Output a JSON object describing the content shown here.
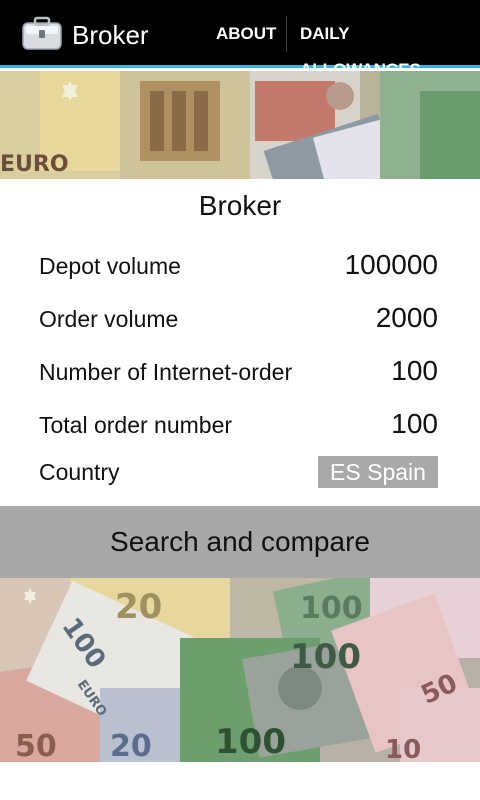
{
  "app": {
    "title": "Broker",
    "icon": "briefcase-icon",
    "menu": {
      "about_label": "ABOUT",
      "daily_allowances_label": "DAILY ALLOWANCES"
    }
  },
  "form": {
    "title": "Broker",
    "depot_volume": {
      "label": "Depot volume",
      "value": "100000"
    },
    "order_volume": {
      "label": "Order volume",
      "value": "2000"
    },
    "internet_orders": {
      "label": "Number of Internet-order",
      "value": "100"
    },
    "total_orders": {
      "label": "Total order number",
      "value": "100"
    },
    "country": {
      "label": "Country",
      "value": "ES Spain"
    },
    "search_button_label": "Search and compare"
  },
  "banners": {
    "top_note_text": "EURO",
    "bottom_note_texts": [
      "100",
      "EURO",
      "20",
      "100",
      "50",
      "10",
      "50",
      "100",
      "20",
      "100"
    ]
  },
  "colors": {
    "actionbar_bg": "#000000",
    "accent_line": "#33b5e5",
    "button_bg": "#a8a8a8",
    "select_bg": "#a9a9a9"
  }
}
